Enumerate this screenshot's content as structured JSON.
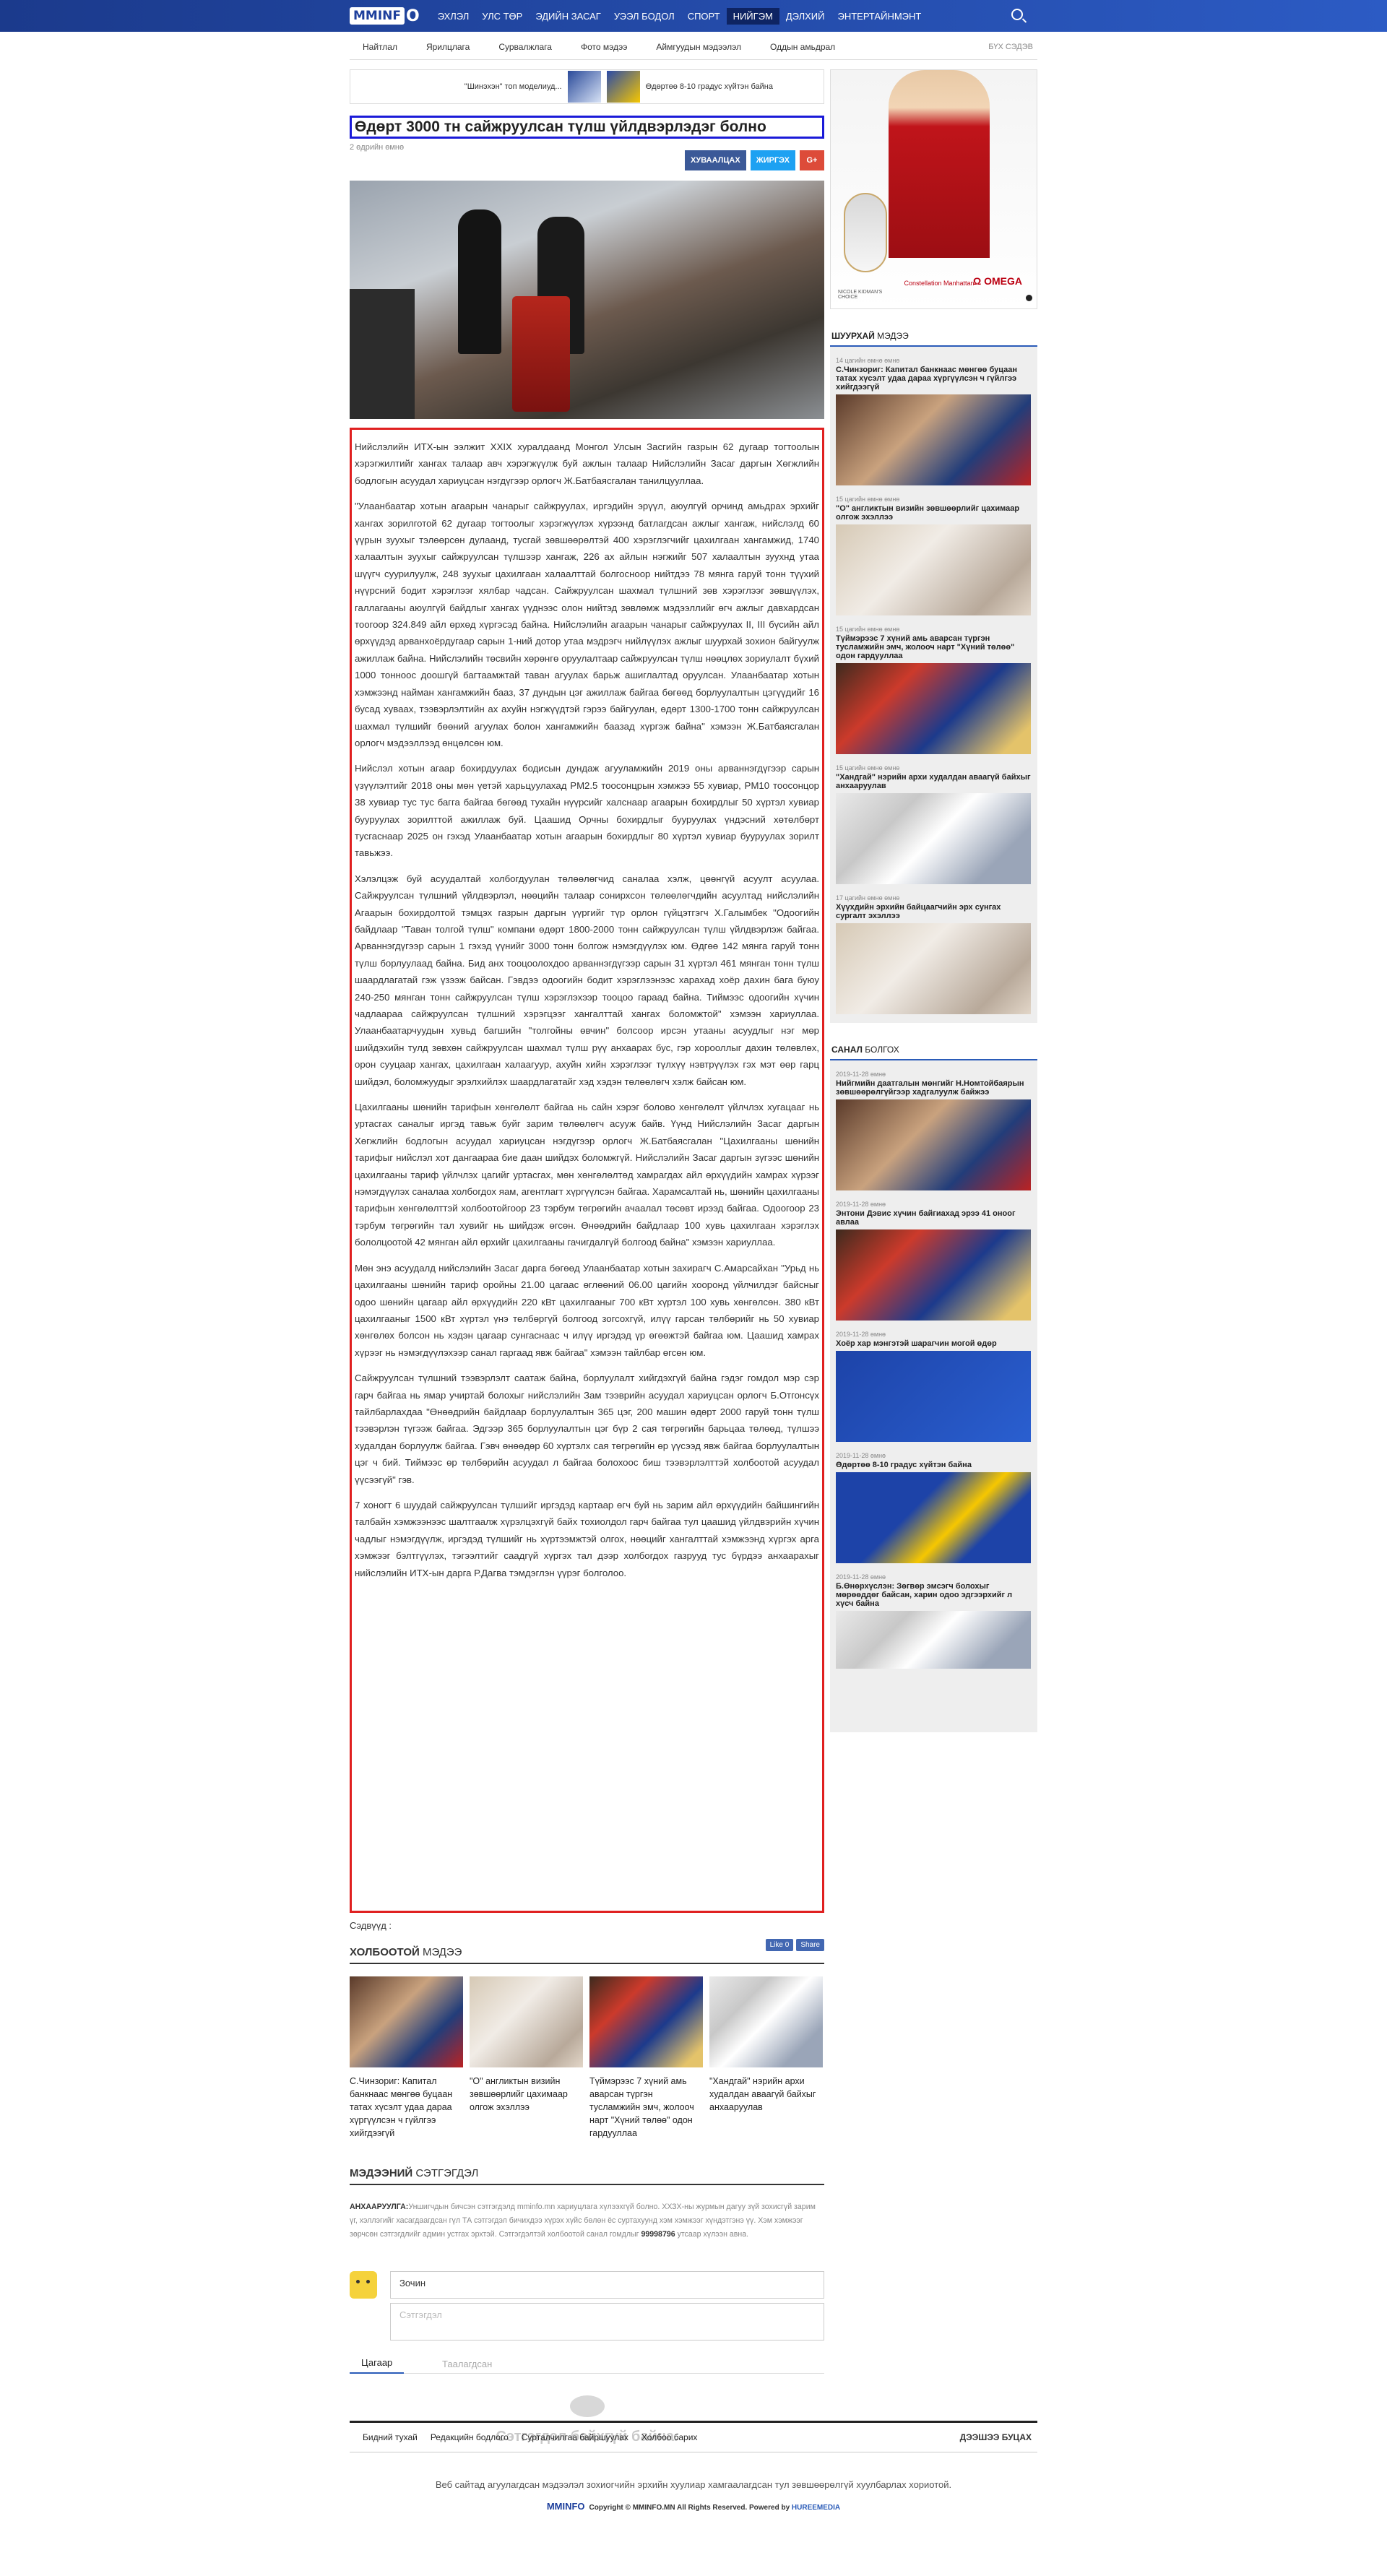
{
  "brand": {
    "logo_box": "MMINF",
    "logo_rest": "O"
  },
  "nav": [
    "ЭХЛЭЛ",
    "УЛС ТӨР",
    "ЭДИЙН ЗАСАГ",
    "УЭЭЛ БОДОЛ",
    "СПОРТ",
    "НИЙГЭМ",
    "ДЭЛХИЙ",
    "ЭНТЕРТАЙНМЭНТ"
  ],
  "subnav": [
    "Найтлал",
    "Ярилцлага",
    "Сурвалжлага",
    "Фото мэдээ",
    "Аймгуудын мэдээлэл",
    "Оддын амьдрал"
  ],
  "subnav_all": "БҮХ СЭДЭВ",
  "ticker": {
    "item1": "\"Шинэхэн\" топ моделиуд...",
    "item2": "Өдөртөө 8-10 градус хүйтэн байна"
  },
  "article": {
    "title": "Өдөрт 3000 тн сайжруулсан түлш үйлдвэрлэдэг болно",
    "date": "2 өдрийн өмнө",
    "share_fb": "ХУВААЛЦАХ",
    "share_tw": "ЖИРГЭХ",
    "share_gp": "G+",
    "paragraphs": [
      "Нийслэлийн ИТХ-ын ээлжит XXIX хуралдаанд Монгол Улсын Засгийн газрын 62 дугаар тогтоолын хэрэгжилтийг хангах талаар авч хэрэгжүүлж буй ажлын талаар Нийслэлийн Засаг даргын Хөгжлийн бодлогын асуудал хариуцсан нэгдүгээр орлогч Ж.Батбаясгалан танилцууллаа.",
      "\"Улаанбаатар хотын агаарын чанарыг сайжруулах, иргэдийн эрүүл, аюулгүй орчинд амьдрах эрхийг хангах зорилготой 62 дугаар тогтоолыг хэрэгжүүлэх хүрээнд батлагдсан ажлыг хангаж, нийслэлд 60 үүрын зуухыг тэлөөрсөн дулаанд, тусгай зөвшөөрөлтэй 400 хэрэглэгчийг цахилгаан хангамжид, 1740 халаалтын зуухыг сайжруулсан түлшээр хангаж, 226 ах айлын нэгжийг 507 халаалтын зуухнд утаа шүүгч суурилуулж, 248 зуухыг цахилгаан халаалттай болгосноор нийтдээ 78 мянга гаруй тонн түүхий нүүрсний бодит хэрэглээг хялбар чадсан. Сайжруулсан шахмал түлшний зөв хэрэглээг зөвшүүлэх, галлагааны аюулгүй байдлыг хангах үүднээс олон нийтэд зөвлөмж мэдээллийг өгч ажлыг давхардсан тоогоор 324.849 айл өрхөд хүргэсэд байна. Нийслэлийн агаарын чанарыг сайжруулах II, III бүсийн айл өрхүүдэд арванхоёрдугаар сарын 1-ний дотор утаа мэдрэгч нийлүүлэх ажлыг шуурхай зохион байгуулж ажиллаж байна. Нийслэлийн төсвийн хөрөнгө оруулалтаар сайжруулсан түлш нөөцлөх зориулалт бүхий 1000 тонноос доошгүй багтаамжтай таван агуулах барьж ашиглалтад оруулсан. Улаанбаатар хотын хэмжээнд найман хангамжийн бааз, 37 дундын цэг ажиллаж байгаа бөгөөд борлуулалтын цэгүүдийг 16 бусад хуваах, тээвэрлэлтийн ах ахуйн нэгжүүдтэй гэрээ байгуулан, өдөрт 1300-1700 тонн сайжруулсан шахмал түлшийг бөөний агуулах болон хангамжийн баазад хүргэж байна\" хэмээн Ж.Батбаясгалан орлогч мэдээллээд өнцөлсөн юм.",
      "Нийслэл хотын агаар бохирдуулах бодисын дундаж агууламжийн 2019 оны арваннэгдүгээр сарын үзүүлэлтийг 2018 оны мөн үетэй харьцуулахад PM2.5 тоосонцрын хэмжээ 55 хувиар, PM10 тоосонцор 38 хувиар тус тус багга байгаа бөгөөд тухайн нүүрсийг халснаар агаарын бохирдлыг 50 хүртэл хувиар бууруулах зорилттой ажиллаж буй. Цаашид Орчны бохирдлыг бууруулах үндэсний хөтөлбөрт тусгаснаар 2025 он гэхэд Улаанбаатар хотын агаарын бохирдлыг 80 хүртэл хувиар бууруулах зорилт тавьжээ.",
      "Хэлэлцэж буй асуудалтай холбогдуулан төлөөлөгчид саналаа хэлж, цөөнгүй асуулт асуулаа. Сайжруулсан түлшний үйлдвэрлэл, нөөцийн талаар сонирхсон төлөөлөгчдийн асуултад нийслэлийн Агаарын бохирдолтой тэмцэх газрын даргын үүргийг түр орлон гүйцэтгэгч Х.Галымбек \"Одоогийн байдлаар \"Таван толгой түлш\" компани өдөрт 1800-2000 тонн сайжруулсан түлш үйлдвэрлэж байгаа. Арваннэгдүгээр сарын 1 гэхэд үүнийг 3000 тонн болгож нэмэгдүүлэх юм. Өдгөө 142 мянга гаруй тонн түлш борлуулаад байна. Бид анх тооцоолохдоо арваннэгдүгээр сарын 31 хүртэл 461 мянган тонн түлш шаардлагатай гэж үзээж байсан. Гэвдээ одоогийн бодит хэрэглээнээс харахад хоёр дахин бага буюу 240-250 мянган тонн сайжруулсан түлш хэрэглэхээр тооцоо гараад байна. Тиймээс одоогийн хүчин чадлаараа сайжруулсан түлшний хэрэгцээг хангалттай хангах боломжтой\" хэмээн хариуллаа. Улаанбаатарчуудын хувьд багшийн \"толгойны өвчин\" болсоор ирсэн утааны асуудлыг нэг мөр шийдэхийн тулд зөвхөн сайжруулсан шахмал түлш рүү анхаарах бус, гэр хорооллыг дахин төлөвлөх, орон сууцаар хангах, цахилгаан халаагуур, ахуйн хийн хэрэглээг түлхүү нэвтрүүлэх гэх мэт өөр гарц шийдэл, боломжуудыг эрэлхийлэх шаардлагатайг хэд хэдэн төлөөлөгч хэлж байсан юм.",
      "Цахилгааны шөнийн тарифын хөнгөлөлт байгаа нь сайн хэрэг болово хөнгөлөлт үйлчлэх хугацааг нь уртасгах саналыг иргэд тавьж буйг зарим төлөөлөгч асууж байв. Үүнд Нийслэлийн Засаг даргын Хөгжлийн бодлогын асуудал хариуцсан нэгдүгээр орлогч Ж.Батбаясгалан \"Цахилгааны шөнийн тарифыг нийслэл хот дангаараа бие даан шийдэх боломжгүй. Нийслэлийн Засаг даргын зүгээс шөнийн цахилгааны тариф үйлчлэх цагийг уртасгах, мөн хөнгөлөлтөд хамрагдах айл өрхүүдийн хамрах хүрээг нэмэгдүүлэх саналаа холбогдох яам, агентлагт хүргүүлсэн байгаа. Харамсалтай нь, шөнийн цахилгааны тарифын хөнгөлөлттэй холбоотойгоор 23 тэрбум төгрөгийн ачаалал төсөвт ирээд байгаа. Одоогоор 23 тэрбум төгрөгийн тал хувийг нь шийдэж өгсөн. Өнөөдрийн байдлаар 100 хувь цахилгаан хэрэглэх бололцоотой 42 мянган айл өрхийг цахилгааны гачигдалгүй болгоод байна\" хэмээн хариуллаа.",
      "Мөн энэ асуудалд нийслэлийн Засаг дарга бөгөөд Улаанбаатар хотын захирагч С.Амарсайхан \"Урьд нь цахилгааны шөнийн тариф оройны 21.00 цагаас өглөөний 06.00 цагийн хооронд үйлчилдэг байсныг одоо шөнийн цагаар айл өрхүүдийн 220 кВт цахилгааныг 700 кВт хүртэл 100 хувь хөнгөлсөн. 380 кВт цахилгааныг 1500 кВт хүртэл үнэ төлбөргүй болгоод зогсохгүй, илүү гарсан төлбөрийг нь 50 хувиар хөнгөлөх болсон нь хэдэн цагаар сунгаснаас ч илүү иргэдэд үр өгөөжтэй байгаа юм. Цаашид хамрах хүрээг нь нэмэгдүүлэхээр санал гаргаад явж байгаа\" хэмээн тайлбар өгсөн юм.",
      "Сайжруулсан түлшний тээвэрлэлт саатаж байна, борлуулалт хийгдэхгүй байна гэдэг гомдол мэр сэр гарч байгаа нь ямар учиртай болохыг нийслэлийн Зам тээврийн асуудал хариуцсан орлогч Б.Отгонсүх тайлбарлахдаа \"Өнөөдрийн байдлаар борлуулалтын 365 цэг, 200 машин өдөрт 2000 гаруй тонн түлш тээвэрлэн түгээж байгаа. Эдгээр 365 борлуулалтын цэг бүр 2 сая төгрөгийн барьцаа төлөөд, түлшээ худалдан борлуулж байгаа. Гэвч өнөөдөр 60 хүртэлх сая төгрөгийн өр үүсээд явж байгаа борлуулалтын цэг ч бий. Тиймээс өр төлбөрийн асуудал л байгаа болохоос биш тээвэрлэлттэй холбоотой асуудал үүсээгүй\" гэв.",
      "7 хоногт 6 шуудай сайжруулсан түлшийг иргэдэд картаар өгч буй нь зарим айл өрхүүдийн байшингийн талбайн хэмжээнээс шалтгаалж хүрэлцэхгүй байх тохиолдол гарч байгаа тул цаашид үйлдвэрийн хүчин чадлыг нэмэгдүүлж, иргэдэд түлшийг нь хүртээмжтэй олгох, нөөцийг хангалттай хэмжээнд хүргэх арга хэмжээг бэлтгүүлэх, тэгээлтийг саадгүй хүргэх тал дээр холбогдох газрууд тус бүрдээ анхаарахыг нийслэлийн ИТХ-ын дарга Р.Дагва тэмдэглэн үүрэг болголоо."
    ]
  },
  "tags_label": "Сэдвүүд :",
  "related": {
    "heading_bold": "ХОЛБООТОЙ",
    "heading_rest": " МЭДЭЭ",
    "like": "Like 0",
    "share": "Share",
    "items": [
      "С.Чинзориг: Капитал банкнаас мөнгөө буцаан татах хүсэлт удаа дараа хүргүүлсэн ч гүйлгээ хийгдээгүй",
      "\"О\" англиктын визийн зөвшөөрлийг цахимаар олгож эхэллээ",
      "Түймэрээс 7 хүний амь аварсан түргэн тусламжийн эмч, жолооч нарт \"Хүний төлөө\" одон гардууллаа",
      "\"Хандгай\" нэрийн архи худалдан аваагүй байхыг анхааруулав"
    ]
  },
  "comments": {
    "heading_bold": "МЭДЭЭНИЙ",
    "heading_rest": " СЭТГЭГДЭЛ",
    "notice_bold": "АНХААРУУЛГА:",
    "notice": "Уншигчдын бичсэн сэтгэгдэлд mminfo.mn хариуцлага хүлээхгүй болно. ХХЗХ-ны журмын дагуу зүй зохисгүй зарим үг, хэллэгийг хасагдаагдсан гүл ТА сэтгэгдэл бичихдээ хүрэх хүйс бөлөн ёс суртахуунд хэм хэмжээг хүндэтгэнэ үү. Хэм хэмжээг зөрчсөн сэтгэгдлийг админ устгах эрхтэй. Сэтгэгдэлтэй холбоотой санал гомдлыг",
    "phone": "99998796",
    "notice_end": " утсаар хүлээн авна.",
    "name_value": "Зочин",
    "text_placeholder": "Сэтгэгдэл",
    "tab_active": "Цагаар",
    "tab_other": "Таалагдсан",
    "empty": "Сэтгэгдэл байхгүй байна."
  },
  "sidebar": {
    "fast_bold": "ШУУРХАЙ",
    "fast_rest": " МЭДЭЭ",
    "fast_items": [
      {
        "date": "14 цагийн өмнө өмнө",
        "title": "С.Чинзориг: Капитал банкнаас мөнгөө буцаан татах хүсэлт удаа дараа хүргүүлсэн ч гүйлгээ хийгдээгүй"
      },
      {
        "date": "15 цагийн өмнө өмнө",
        "title": "\"О\" англиктын визийн зөвшөөрлийг цахимаар олгож эхэллээ"
      },
      {
        "date": "15 цагийн өмнө өмнө",
        "title": "Түймэрээс 7 хүний амь аварсан түргэн тусламжийн эмч, жолооч нарт \"Хүний төлөө\" одон гардууллаа"
      },
      {
        "date": "15 цагийн өмнө өмнө",
        "title": "\"Хандгай\" нэрийн архи худалдан аваагүй байхыг анхааруулав"
      },
      {
        "date": "17 цагийн өмнө өмнө",
        "title": "Хүүхдийн эрхийн байцаагчийн эрх сунгах сургалт эхэллээ"
      }
    ],
    "opinion_bold": "САНАЛ",
    "opinion_rest": " БОЛГОХ",
    "opinion_items": [
      {
        "date": "2019-11-28 өмнө",
        "title": "Нийгмийн даатгалын мөнгийг Н.Номтойбаярын зөвшөөрөлгүйгээр хадгалуулж байжээ"
      },
      {
        "date": "2019-11-28 өмнө",
        "title": "Энтони Дэвис хүчин байгиахад эрээ 41 оноог авлаа"
      },
      {
        "date": "2019-11-28 өмнө",
        "title": "Хоёр хар мэнгэтэй шарагчин могой өдөр"
      },
      {
        "date": "2019-11-28 өмнө",
        "title": "Өдөртөө 8-10 градус хүйтэн байна"
      },
      {
        "date": "2019-11-28 өмнө",
        "title": "Б.Өнөрхүслэн: Зөгвөр эмсэгч болохыг мөрөөддөг байсан, харин одоо эдгээрхийг л хүсч байна"
      }
    ],
    "ad_t1": "NICOLE KIDMAN'S CHOICE",
    "ad_t2": "Constellation Manhattan",
    "ad_t3": "Ω OMEGA"
  },
  "footer": {
    "links": [
      "Бидний тухай",
      "Редакцийн бодлого",
      "Сурталчилгаа байршуулах",
      "Холбоо барих"
    ],
    "back": "ДЭЭШЭЭ БУЦАХ",
    "line1": "Веб сайтад агуулагдсан мэдээлэл зохиогчийн эрхийн хуулиар хамгаалагдсан тул зөвшөөрөлгүй хуулбарлах хориотой.",
    "logo": "MMINFO",
    "copyright": "Copyright © MMINFO.MN All Rights Reserved. Powered by",
    "powered": "HUREEMEDIA"
  }
}
